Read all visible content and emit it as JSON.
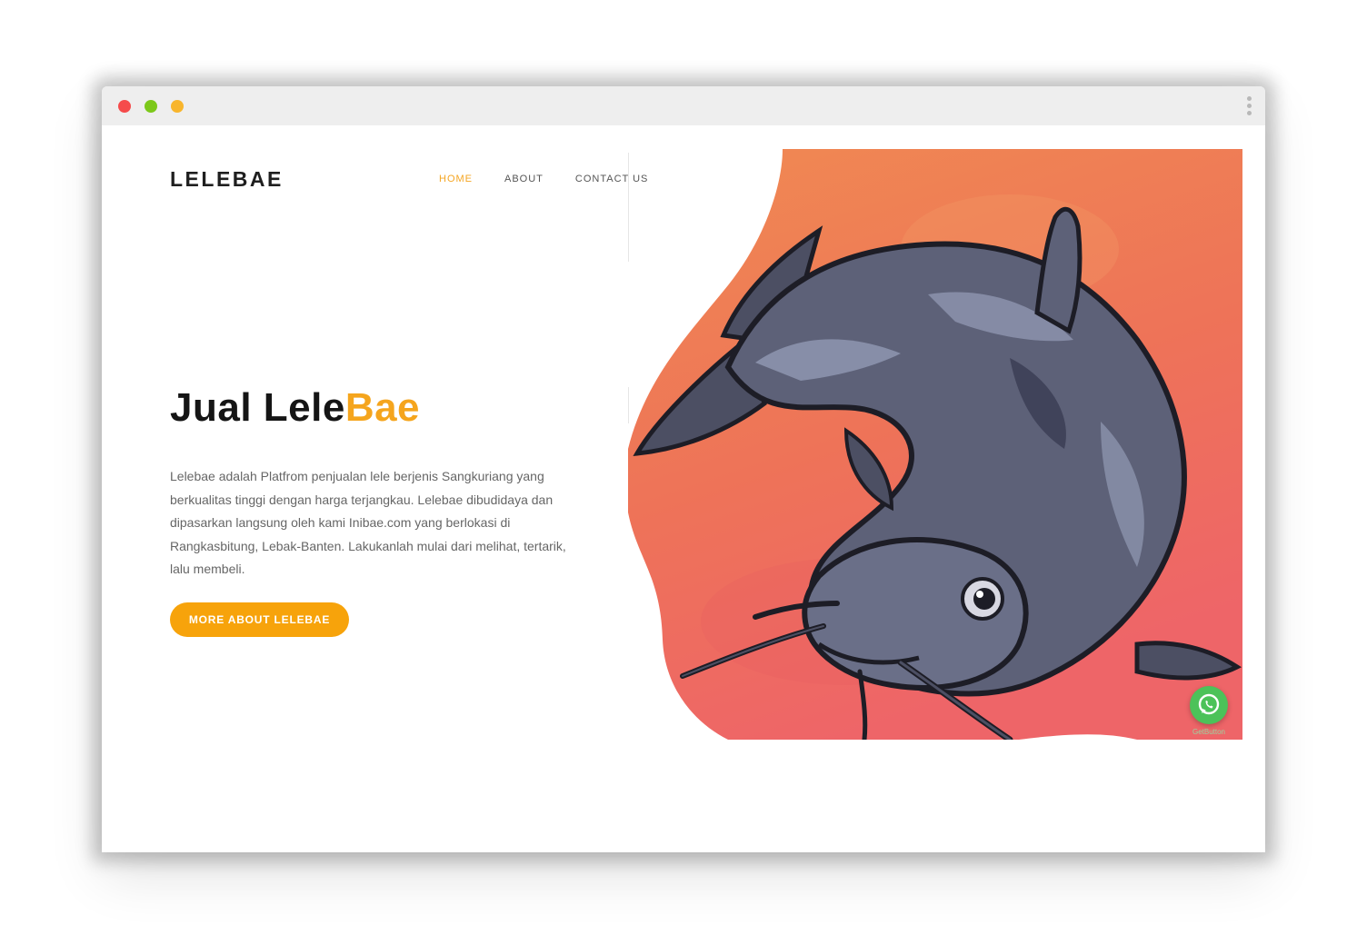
{
  "window": {
    "controls": [
      "close",
      "minimize",
      "maximize"
    ],
    "menu_icon": "kebab-menu-icon"
  },
  "brand": {
    "logo": "LELEBAE"
  },
  "nav": {
    "items": [
      {
        "label": "HOME",
        "active": true
      },
      {
        "label": "ABOUT",
        "active": false
      },
      {
        "label": "CONTACT US",
        "active": false
      }
    ]
  },
  "hero": {
    "title_main": "Jual Lele",
    "title_accent": "Bae",
    "description": "Lelebae adalah Platfrom penjualan lele berjenis Sangkuriang yang berkualitas tinggi dengan harga terjangkau. Lelebae dibudidaya dan dipasarkan langsung oleh kami Inibae.com yang berlokasi di Rangkasbitung, Lebak-Banten. Lakukanlah mulai dari melihat, tertarik, lalu membeli.",
    "cta_label": "MORE ABOUT LELEBAE",
    "image_subject": "catfish-illustration"
  },
  "whatsapp_widget": {
    "icon": "whatsapp-icon",
    "label": "GetButton"
  },
  "colors": {
    "accent": "#f5a623",
    "button": "#f7a30b",
    "whatsapp": "#4cc259",
    "hero_bg_top": "#f08a52",
    "hero_bg_bottom": "#ee6568"
  }
}
